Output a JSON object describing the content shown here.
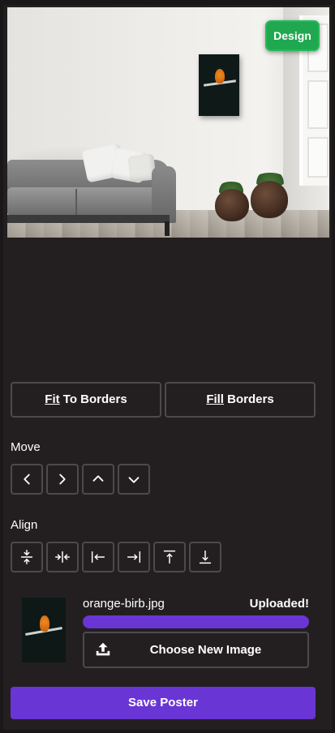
{
  "preview": {
    "design_label": "Design"
  },
  "sizing": {
    "fit_prefix": "Fit",
    "fit_suffix": " To Borders",
    "fill_prefix": "Fill",
    "fill_suffix": " Borders"
  },
  "move": {
    "label": "Move",
    "buttons": [
      "chevron-left-icon",
      "chevron-right-icon",
      "chevron-up-icon",
      "chevron-down-icon"
    ]
  },
  "align": {
    "label": "Align",
    "buttons": [
      "align-center-vertical-icon",
      "align-center-horizontal-icon",
      "align-left-icon",
      "align-right-icon",
      "align-top-icon",
      "align-bottom-icon"
    ]
  },
  "upload": {
    "filename": "orange-birb.jpg",
    "status": "Uploaded!",
    "progress": 1.0,
    "choose_label": "Choose New Image"
  },
  "actions": {
    "save_label": "Save Poster"
  },
  "colors": {
    "background": "#231f20",
    "accent": "#6a35d5",
    "design": "#1fa84f",
    "border": "#4c4a4e"
  }
}
